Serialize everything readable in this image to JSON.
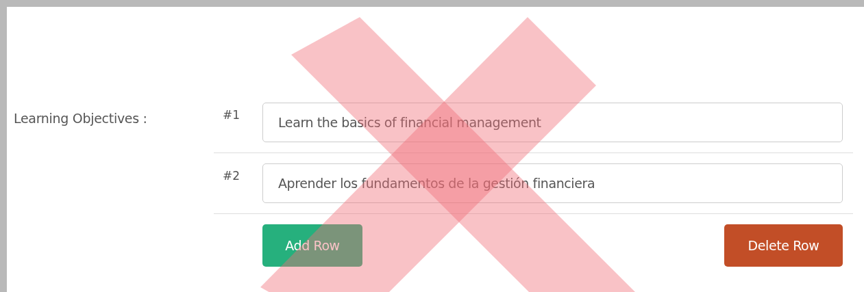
{
  "form": {
    "label": "Learning Objectives :",
    "objectives": [
      {
        "number": "#1",
        "value": "Learn the basics of financial management"
      },
      {
        "number": "#2",
        "value": "Aprender los fundamentos de la gestión financiera"
      }
    ],
    "buttons": [
      {
        "kind": "add",
        "label": "Add Row"
      },
      {
        "kind": "delete",
        "label": "Delete Row"
      }
    ]
  },
  "overlay": {
    "kind": "cross"
  }
}
